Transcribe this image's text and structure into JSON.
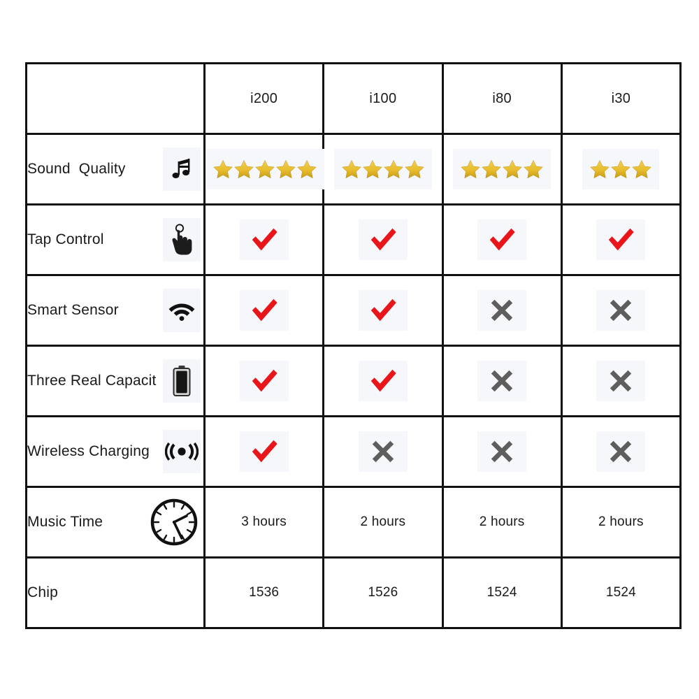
{
  "table": {
    "header": {
      "blank_label": "",
      "models": [
        "i200",
        "i100",
        "i80",
        "i30"
      ]
    },
    "rows": [
      {
        "label": "Sound  Quality",
        "icon": "music-note-icon",
        "type": "stars",
        "values": [
          5,
          4,
          4,
          3
        ],
        "max_stars": 5
      },
      {
        "label": "Tap Control",
        "icon": "tap-hand-icon",
        "type": "mark",
        "values": [
          "check",
          "check",
          "check",
          "check"
        ]
      },
      {
        "label": "Smart Sensor",
        "icon": "wifi-icon",
        "type": "mark",
        "values": [
          "check",
          "check",
          "cross",
          "cross"
        ]
      },
      {
        "label": "Three Real Capacit",
        "icon": "battery-icon",
        "type": "mark",
        "values": [
          "check",
          "check",
          "cross",
          "cross"
        ]
      },
      {
        "label": "Wireless Charging",
        "icon": "wireless-signal-icon",
        "type": "mark",
        "values": [
          "check",
          "cross",
          "cross",
          "cross"
        ]
      },
      {
        "label": "Music Time",
        "icon": "clock-icon",
        "type": "text",
        "values": [
          "3 hours",
          "2 hours",
          "2 hours",
          "2 hours"
        ]
      },
      {
        "label": "Chip",
        "icon": "none",
        "type": "text",
        "values": [
          "1536",
          "1526",
          "1524",
          "1524"
        ]
      }
    ]
  },
  "colors": {
    "border": "#111111",
    "page_background": "#ffffff",
    "badge_background": "#f6f7fa",
    "check_red": "#e8151b",
    "cross_gray": "#5e5e5e",
    "star_gold": "#e8bc2e",
    "text": "#1a1a1a"
  }
}
